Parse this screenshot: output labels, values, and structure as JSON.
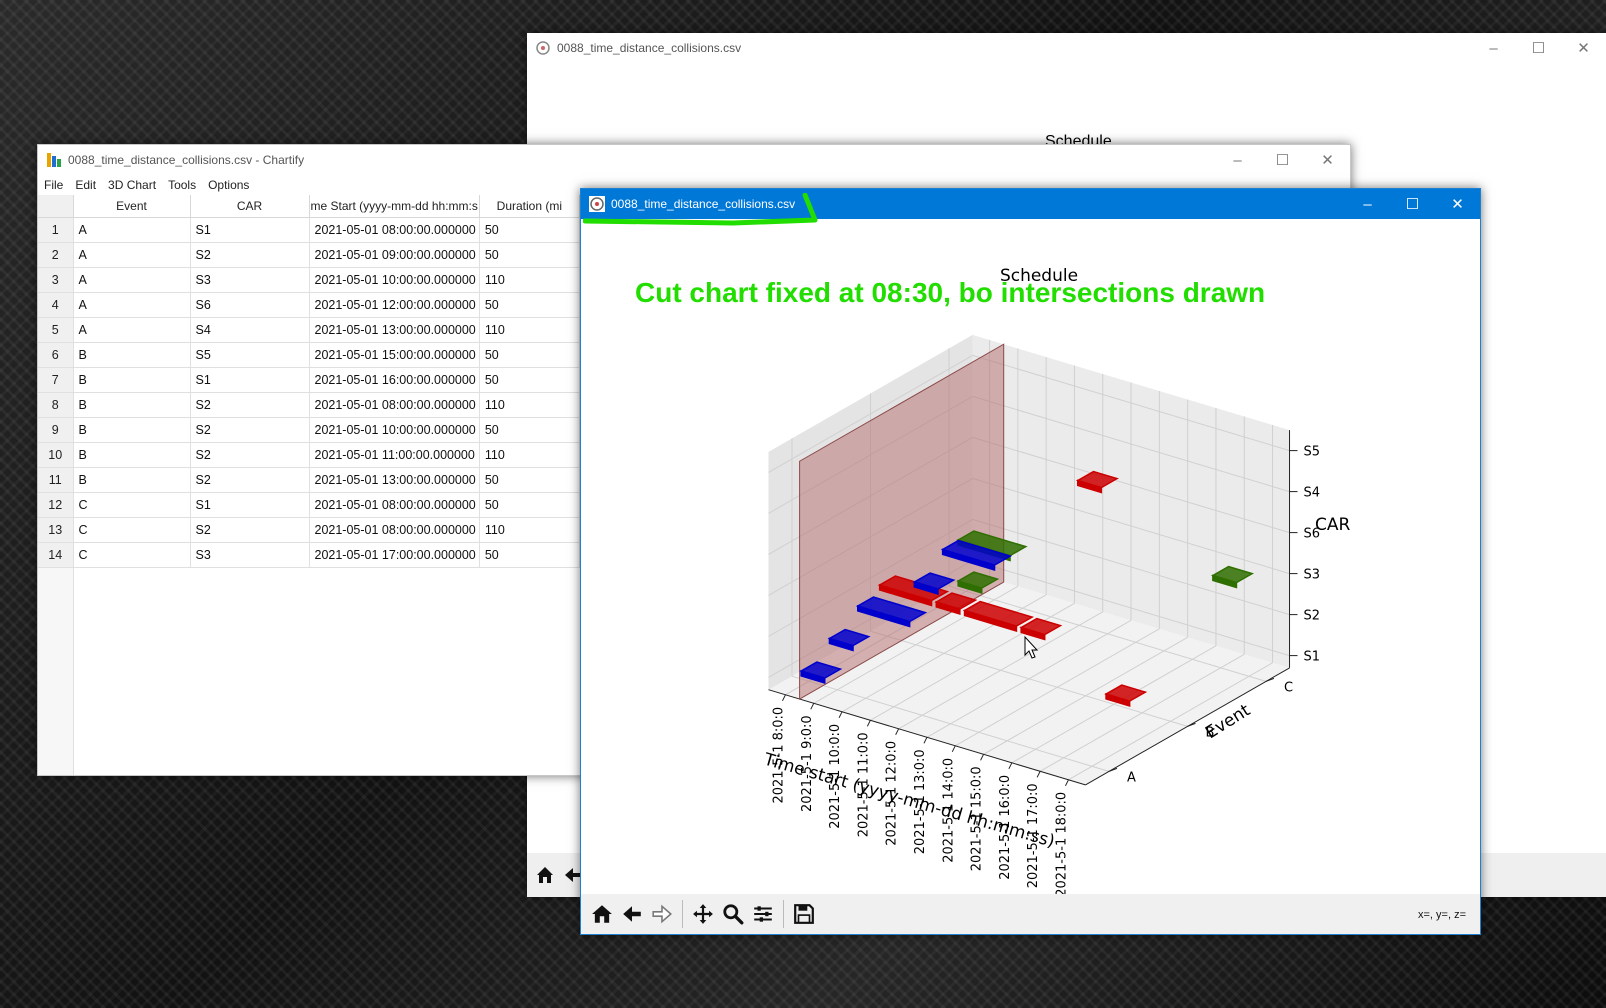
{
  "back_window": {
    "title": "0088_time_distance_collisions.csv",
    "chart_title": "Schedule"
  },
  "table_window": {
    "title": "0088_time_distance_collisions.csv - Chartify",
    "menu": [
      "File",
      "Edit",
      "3D Chart",
      "Tools",
      "Options"
    ],
    "columns": [
      "Event",
      "CAR",
      "me Start (yyyy-mm-dd hh:mm:s",
      "Duration (mi"
    ],
    "rows": [
      [
        "1",
        "A",
        "S1",
        "2021-05-01 08:00:00.000000",
        "50"
      ],
      [
        "2",
        "A",
        "S2",
        "2021-05-01 09:00:00.000000",
        "50"
      ],
      [
        "3",
        "A",
        "S3",
        "2021-05-01 10:00:00.000000",
        "110"
      ],
      [
        "4",
        "A",
        "S6",
        "2021-05-01 12:00:00.000000",
        "50"
      ],
      [
        "5",
        "A",
        "S4",
        "2021-05-01 13:00:00.000000",
        "110"
      ],
      [
        "6",
        "B",
        "S5",
        "2021-05-01 15:00:00.000000",
        "50"
      ],
      [
        "7",
        "B",
        "S1",
        "2021-05-01 16:00:00.000000",
        "50"
      ],
      [
        "8",
        "B",
        "S2",
        "2021-05-01 08:00:00.000000",
        "110"
      ],
      [
        "9",
        "B",
        "S2",
        "2021-05-01 10:00:00.000000",
        "50"
      ],
      [
        "10",
        "B",
        "S2",
        "2021-05-01 11:00:00.000000",
        "110"
      ],
      [
        "11",
        "B",
        "S2",
        "2021-05-01 13:00:00.000000",
        "50"
      ],
      [
        "12",
        "C",
        "S1",
        "2021-05-01 08:00:00.000000",
        "50"
      ],
      [
        "13",
        "C",
        "S2",
        "2021-05-01 08:00:00.000000",
        "110"
      ],
      [
        "14",
        "C",
        "S3",
        "2021-05-01 17:00:00.000000",
        "50"
      ]
    ]
  },
  "plot_window": {
    "title": "0088_time_distance_collisions.csv",
    "annotation": "Cut chart fixed at 08:30, bo intersections drawn",
    "annotation_color": "#22dd00",
    "coords_readout": "x=, y=, z=",
    "toolbar_icons": [
      "home-icon",
      "back-arrow-icon",
      "forward-arrow-icon",
      "pan-icon",
      "zoom-icon",
      "configure-icon",
      "save-icon"
    ]
  },
  "chart_data": {
    "type": "3d-bar-schedule",
    "title": "Schedule",
    "xlabel": "Time start (yyyy-mm-dd hh:mm:ss)",
    "ylabel": "Event",
    "zlabel": "CAR",
    "x_ticks": [
      "2021-5-1 8:0:0",
      "2021-5-1 9:0:0",
      "2021-5-1 10:0:0",
      "2021-5-1 11:0:0",
      "2021-5-1 12:0:0",
      "2021-5-1 13:0:0",
      "2021-5-1 14:0:0",
      "2021-5-1 15:0:0",
      "2021-5-1 16:0:0",
      "2021-5-1 17:0:0",
      "2021-5-1 18:0:0"
    ],
    "y_ticks": [
      "A",
      "B",
      "C"
    ],
    "z_ticks": [
      "S1",
      "S2",
      "S3",
      "S6",
      "S4",
      "S5"
    ],
    "cut_plane_time": "08:30",
    "cut_plane_color": "#b36b6b",
    "series_colors": {
      "A": "#0000cc",
      "B": "#cc0000",
      "C": "#2f6f00"
    },
    "bars": [
      {
        "event": "A",
        "car": "S1",
        "start": "08:00",
        "duration_min": 50
      },
      {
        "event": "A",
        "car": "S2",
        "start": "09:00",
        "duration_min": 50
      },
      {
        "event": "A",
        "car": "S3",
        "start": "10:00",
        "duration_min": 110
      },
      {
        "event": "A",
        "car": "S6",
        "start": "12:00",
        "duration_min": 50
      },
      {
        "event": "A",
        "car": "S4",
        "start": "13:00",
        "duration_min": 110
      },
      {
        "event": "B",
        "car": "S5",
        "start": "15:00",
        "duration_min": 50
      },
      {
        "event": "B",
        "car": "S1",
        "start": "16:00",
        "duration_min": 50
      },
      {
        "event": "B",
        "car": "S2",
        "start": "08:00",
        "duration_min": 110
      },
      {
        "event": "B",
        "car": "S2",
        "start": "10:00",
        "duration_min": 50
      },
      {
        "event": "B",
        "car": "S2",
        "start": "11:00",
        "duration_min": 110
      },
      {
        "event": "B",
        "car": "S2",
        "start": "13:00",
        "duration_min": 50
      },
      {
        "event": "C",
        "car": "S1",
        "start": "08:00",
        "duration_min": 50
      },
      {
        "event": "C",
        "car": "S2",
        "start": "08:00",
        "duration_min": 110
      },
      {
        "event": "C",
        "car": "S3",
        "start": "17:00",
        "duration_min": 50
      }
    ]
  }
}
